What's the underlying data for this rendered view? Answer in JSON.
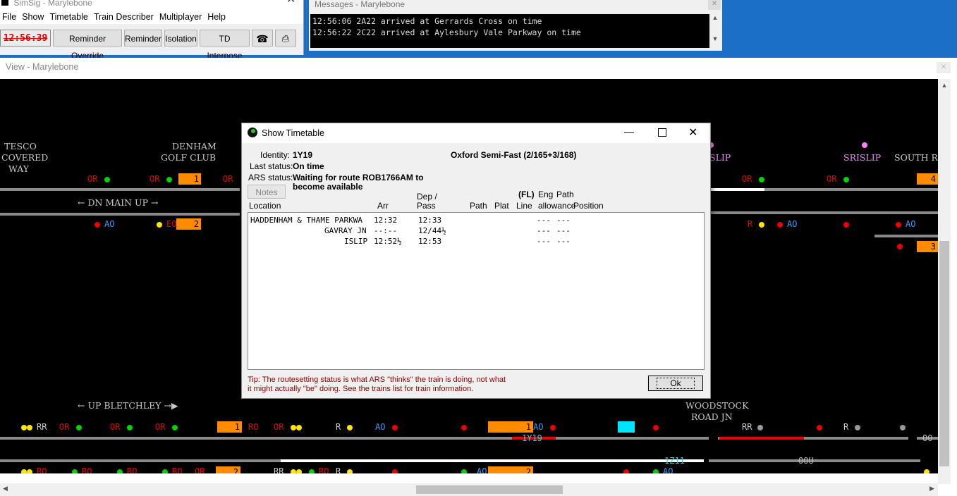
{
  "main_window": {
    "title": "SimSig - Marylebone",
    "menu": [
      "File",
      "Show",
      "Timetable",
      "Train Describer",
      "Multiplayer",
      "Help"
    ],
    "clock": "12:56:39",
    "toolbar": {
      "reminder_override": "Reminder Override",
      "reminder": "Reminder",
      "isolation": "Isolation",
      "td_interpose": "TD Interpose"
    }
  },
  "messages": {
    "title": "Messages - Marylebone",
    "lines": [
      "12:56:06 2A22 arrived at Gerrards Cross on time",
      "12:56:22 2C22 arrived at Aylesbury Vale Parkway on time"
    ]
  },
  "view": {
    "title": "View - Marylebone",
    "labels": {
      "tesco1": "TESCO",
      "tesco2": "COVERED",
      "tesco3": "WAY",
      "denham1": "DENHAM",
      "denham2": "GOLF CLUB",
      "islip": "SLIP",
      "srislip": "SRISLIP",
      "south_ru": "SOUTH RU",
      "dn_main_up": "← DN MAIN UP →",
      "up_bletchley": "← UP BLETCHLEY →▶",
      "woodstock1": "WOODSTOCK",
      "woodstock2": "ROAD JN",
      "train_1y19": "1Y19",
      "train_1z11": "1Z11",
      "oou": "OOU",
      "oo": "OO"
    },
    "berths": {
      "b1": "1",
      "b2": "2",
      "b4": "4",
      "b3": "3",
      "b5": "1",
      "b6": "1",
      "b7": "2",
      "b8": "2"
    },
    "signal_codes": {
      "or": "OR",
      "ao": "AO",
      "r": "R",
      "rr": "RR",
      "ro": "RO",
      "eo": "EO"
    }
  },
  "dialog": {
    "title": "Show Timetable",
    "identity_label": "Identity:",
    "identity": "1Y19",
    "description": "Oxford Semi-Fast (2/165+3/168)",
    "last_status_label": "Last status:",
    "last_status": "On time",
    "ars_status_label": "ARS status:",
    "ars_status_line1": "Waiting for route ROB1766AM to",
    "ars_status_line2": "become available",
    "notes_button": "Notes",
    "headers": {
      "location": "Location",
      "arr": "Arr",
      "dep1": "Dep /",
      "dep2": "Pass",
      "path": "Path",
      "plat": "Plat",
      "fl": "(FL)",
      "line": "Line",
      "eng1": "Eng",
      "eng2": "allowance",
      "pathpos1": "Path",
      "pathpos2": "Position"
    },
    "rows": [
      {
        "location": "HADDENHAM & THAME PARKWA",
        "arr": "12:32",
        "dep": "12:33",
        "eng": "---",
        "pos": "---"
      },
      {
        "location": "GAVRAY JN",
        "arr": "--:--",
        "dep": "12/44½",
        "eng": "---",
        "pos": "---"
      },
      {
        "location": "ISLIP",
        "arr": "12:52½",
        "dep": "12:53",
        "eng": "---",
        "pos": "---"
      }
    ],
    "tip_line1": "Tip: The routesetting status is what ARS \"thinks\" the train is doing, not what",
    "tip_line2": "it might actually \"be\" doing. See the trains list for train information.",
    "ok_button": "Ok"
  }
}
